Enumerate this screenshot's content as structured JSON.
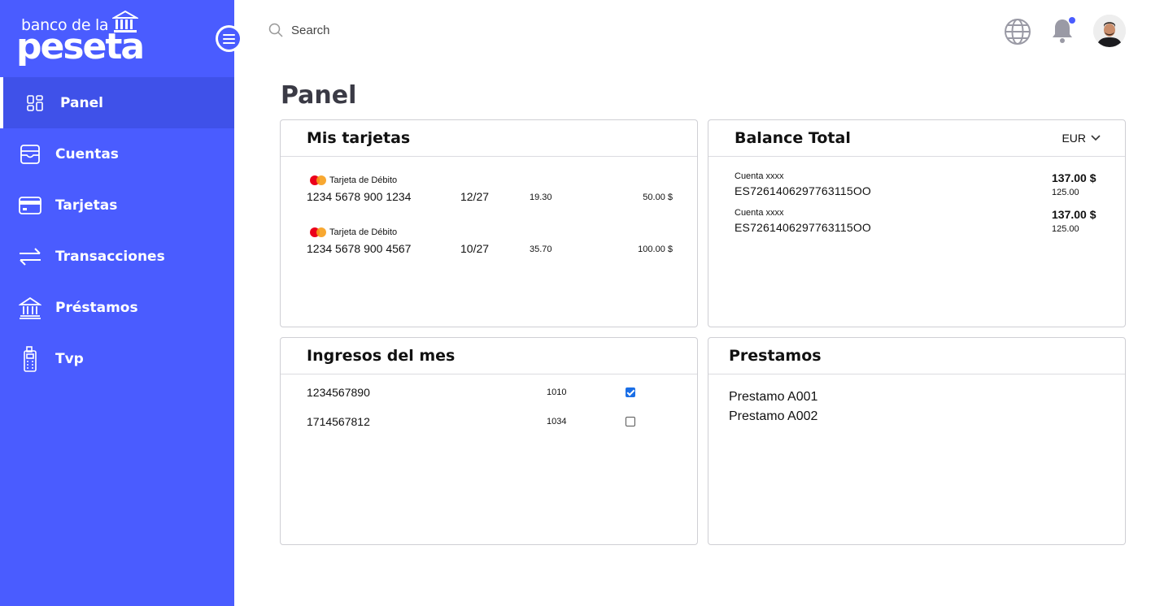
{
  "brand": {
    "line1": "banco de la",
    "line2": "peseta"
  },
  "nav": [
    {
      "label": "Panel",
      "active": true,
      "icon": "dashboard-icon"
    },
    {
      "label": "Cuentas",
      "active": false,
      "icon": "wallet-icon"
    },
    {
      "label": "Tarjetas",
      "active": false,
      "icon": "credit-card-icon"
    },
    {
      "label": "Transacciones",
      "active": false,
      "icon": "transfer-arrows-icon"
    },
    {
      "label": "Préstamos",
      "active": false,
      "icon": "bank-icon"
    },
    {
      "label": "Tvp",
      "active": false,
      "icon": "pos-terminal-icon"
    }
  ],
  "search": {
    "placeholder": "Search"
  },
  "page": {
    "title": "Panel"
  },
  "tarjetas": {
    "title": "Mis tarjetas",
    "cards": [
      {
        "type": "Tarjeta de Débito",
        "number": "1234 5678 900 1234",
        "expiry": "12/27",
        "amount": "19.30",
        "balance": "50.00 $"
      },
      {
        "type": "Tarjeta de Débito",
        "number": "1234 5678 900 4567",
        "expiry": "10/27",
        "amount": "35.70",
        "balance": "100.00 $"
      }
    ]
  },
  "balance": {
    "title": "Balance Total",
    "currency": "EUR",
    "accounts": [
      {
        "label": "Cuenta xxxx",
        "iban": "ES7261406297763115OO",
        "total": "137.00 $",
        "sub": "125.00"
      },
      {
        "label": "Cuenta xxxx",
        "iban": "ES7261406297763115OO",
        "total": "137.00 $",
        "sub": "125.00"
      }
    ]
  },
  "ingresos": {
    "title": "Ingresos del mes",
    "rows": [
      {
        "id": "1234567890",
        "value": "1010",
        "checked": true
      },
      {
        "id": "1714567812",
        "value": "1034",
        "checked": false
      }
    ]
  },
  "prestamos": {
    "title": "Prestamos",
    "items": [
      "Prestamo A001",
      "Prestamo A002"
    ]
  },
  "colors": {
    "sidebar": "#4a5cff",
    "sidebar_active": "#3f51e9",
    "notification_dot": "#4a5cff",
    "checkbox": "#1a6ee6"
  }
}
